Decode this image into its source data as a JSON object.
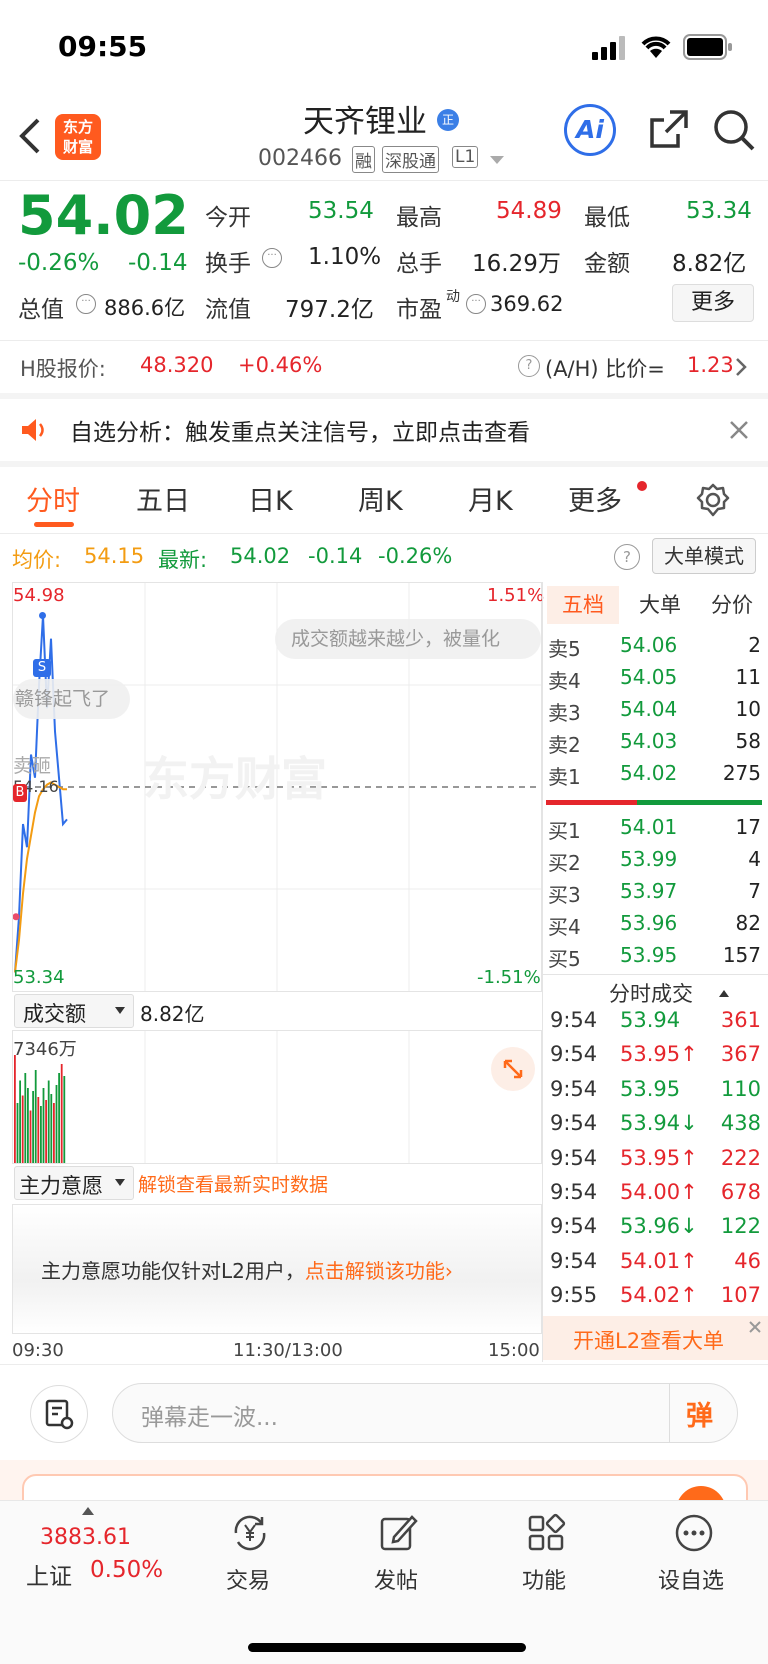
{
  "status_bar": {
    "time": "09:55"
  },
  "header": {
    "logo_text": "东方\n财富",
    "stock_name": "天齐锂业",
    "stock_code": "002466",
    "tags": [
      "融",
      "深股通",
      "L1"
    ],
    "ai_label": "Ai"
  },
  "quote": {
    "price": "54.02",
    "change_pct": "-0.26%",
    "change": "-0.14",
    "stats": [
      {
        "label": "今开",
        "value": "53.54",
        "color": "#129a3c"
      },
      {
        "label": "最高",
        "value": "54.89",
        "color": "#e5262c"
      },
      {
        "label": "最低",
        "value": "53.34",
        "color": "#129a3c"
      },
      {
        "label": "换手",
        "value": "1.10%",
        "color": "#222222"
      },
      {
        "label": "总手",
        "value": "16.29万",
        "color": "#222222"
      },
      {
        "label": "金额",
        "value": "8.82亿",
        "color": "#222222"
      },
      {
        "label": "总值",
        "value": "886.6亿",
        "color": "#222222"
      },
      {
        "label": "流值",
        "value": "797.2亿",
        "color": "#222222"
      },
      {
        "label": "市盈",
        "value": "369.62",
        "color": "#222222"
      }
    ],
    "pe_sup": "动",
    "more_button": "更多"
  },
  "h_share": {
    "label": "H股报价:",
    "price": "48.320",
    "change": "+0.46%",
    "ratio_label": "(A/H) 比价=",
    "ratio_value": "1.23"
  },
  "notice": {
    "text": "自选分析：触发重点关注信号，立即点击查看"
  },
  "tabs": [
    "分时",
    "五日",
    "日K",
    "周K",
    "月K",
    "更多"
  ],
  "info_line": {
    "avg_label": "均价:",
    "avg_value": "54.15",
    "latest_label": "最新:",
    "latest_value": "54.02",
    "change": "-0.14",
    "change_pct": "-0.26%",
    "big_order_button": "大单模式"
  },
  "chart_data": {
    "type": "line",
    "ylim": [
      53.34,
      54.98
    ],
    "y_labels": {
      "top": "54.98",
      "bottom": "53.34",
      "top_pct": "1.51%",
      "bottom_pct": "-1.51%",
      "ref": "54.16"
    },
    "x_labels": [
      "09:30",
      "11:30/13:00",
      "15:00"
    ],
    "series": [
      {
        "values": [
          53.36,
          53.6,
          54.0,
          53.9,
          54.3,
          54.2,
          54.6,
          54.9,
          54.5,
          54.8,
          54.4,
          54.2,
          54.0,
          54.02
        ]
      },
      {
        "values": [
          53.36,
          53.5,
          53.7,
          53.85,
          53.95,
          54.05,
          54.12,
          54.15,
          54.17,
          54.18,
          54.17,
          54.16,
          54.15,
          54.15
        ]
      }
    ],
    "volume_values": [
      72,
      40,
      55,
      45,
      60,
      50,
      35,
      48,
      62,
      44,
      38,
      50,
      42,
      55,
      46,
      40,
      52,
      60,
      66,
      58
    ]
  },
  "danmaku": {
    "msg1": "成交额越来越少，被量化",
    "msg2": "赣锋起飞了",
    "msg3": "卖砸",
    "watermark": "东方财富",
    "s_badge": "S",
    "b_badge": "B"
  },
  "volume": {
    "selector": "成交额",
    "value": "8.82亿",
    "max_label": "7346万"
  },
  "main_force": {
    "selector": "主力意愿",
    "unlock_link": "解锁查看最新实时数据",
    "notice_text": "主力意愿功能仅针对L2用户，",
    "notice_link": "点击解锁该功能"
  },
  "order_book": {
    "tabs": [
      "五档",
      "大单",
      "分价"
    ],
    "asks": [
      {
        "label": "卖5",
        "price": "54.06",
        "vol": "2"
      },
      {
        "label": "卖4",
        "price": "54.05",
        "vol": "11"
      },
      {
        "label": "卖3",
        "price": "54.04",
        "vol": "10"
      },
      {
        "label": "卖2",
        "price": "54.03",
        "vol": "58"
      },
      {
        "label": "卖1",
        "price": "54.02",
        "vol": "275"
      }
    ],
    "bids": [
      {
        "label": "买1",
        "price": "54.01",
        "vol": "17"
      },
      {
        "label": "买2",
        "price": "53.99",
        "vol": "4"
      },
      {
        "label": "买3",
        "price": "53.97",
        "vol": "7"
      },
      {
        "label": "买4",
        "price": "53.96",
        "vol": "82"
      },
      {
        "label": "买5",
        "price": "53.95",
        "vol": "157"
      }
    ],
    "sell_ratio": 0.42,
    "trades_title": "分时成交",
    "trades": [
      {
        "time": "9:54",
        "price": "53.94",
        "arrow": "",
        "vol": "361",
        "color": "#e5262c"
      },
      {
        "time": "9:54",
        "price": "53.95↑",
        "arrow": "up",
        "vol": "367",
        "color": "#e5262c"
      },
      {
        "time": "9:54",
        "price": "53.95",
        "arrow": "",
        "vol": "110",
        "color": "#129a3c"
      },
      {
        "time": "9:54",
        "price": "53.94↓",
        "arrow": "down",
        "vol": "438",
        "color": "#129a3c"
      },
      {
        "time": "9:54",
        "price": "53.95↑",
        "arrow": "up",
        "vol": "222",
        "color": "#e5262c"
      },
      {
        "time": "9:54",
        "price": "54.00↑",
        "arrow": "up",
        "vol": "678",
        "color": "#e5262c"
      },
      {
        "time": "9:54",
        "price": "53.96↓",
        "arrow": "down",
        "vol": "122",
        "color": "#129a3c"
      },
      {
        "time": "9:54",
        "price": "54.01↑",
        "arrow": "up",
        "vol": "46",
        "color": "#e5262c"
      },
      {
        "time": "9:55",
        "price": "54.02↑",
        "arrow": "up",
        "vol": "107",
        "color": "#e5262c"
      }
    ],
    "l2_button": "开通L2查看大单"
  },
  "comment_bar": {
    "placeholder": "弹幕走一波...",
    "send_icon_text": "弹"
  },
  "bottom_nav": {
    "index_value": "3883.61",
    "index_name": "上证",
    "index_change": "0.50%",
    "items": [
      "交易",
      "发帖",
      "功能",
      "设自选"
    ]
  }
}
